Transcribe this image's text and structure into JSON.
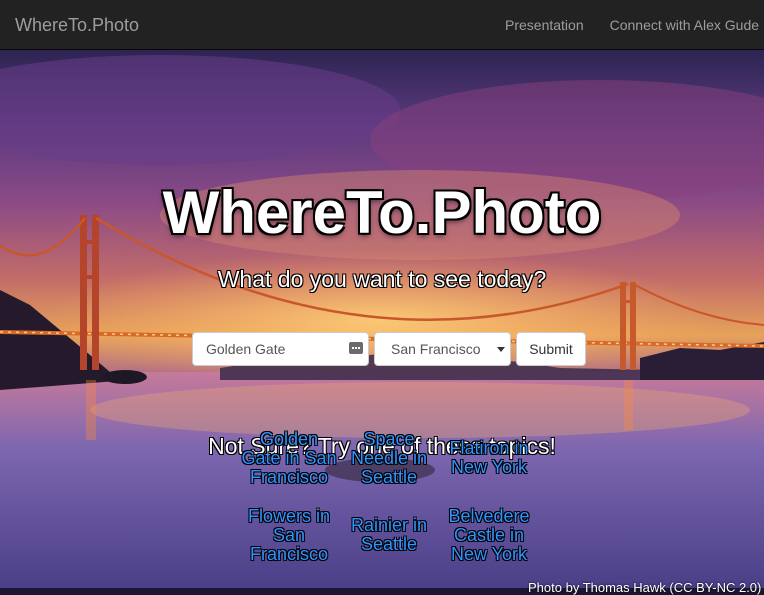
{
  "navbar": {
    "brand": "WhereTo.Photo",
    "links": [
      "Presentation",
      "Connect with Alex Gude"
    ]
  },
  "hero": {
    "title": "WhereTo.Photo",
    "subtitle": "What do you want to see today?"
  },
  "search": {
    "query_value": "Golden Gate",
    "city_selected": "San Francisco",
    "submit_label": "Submit"
  },
  "topics": {
    "heading": "Not Sure? Try one of these topics!",
    "items": [
      "Golden Gate in San Francisco",
      "Space Needle in Seattle",
      "Flatiron in New York",
      "Flowers in San Francisco",
      "Rainier in Seattle",
      "Belvedere Castle in New York"
    ]
  },
  "photo_credit": "Photo by Thomas Hawk (CC BY-NC 2.0)",
  "colors": {
    "navbar_bg": "#222222",
    "nav_text": "#9d9d9d",
    "topic_link": "#3094ff",
    "hero_text": "#ffffff"
  },
  "icons": {
    "input_icon": "keyboard-icon",
    "select_arrow": "triangle-down-icon"
  }
}
